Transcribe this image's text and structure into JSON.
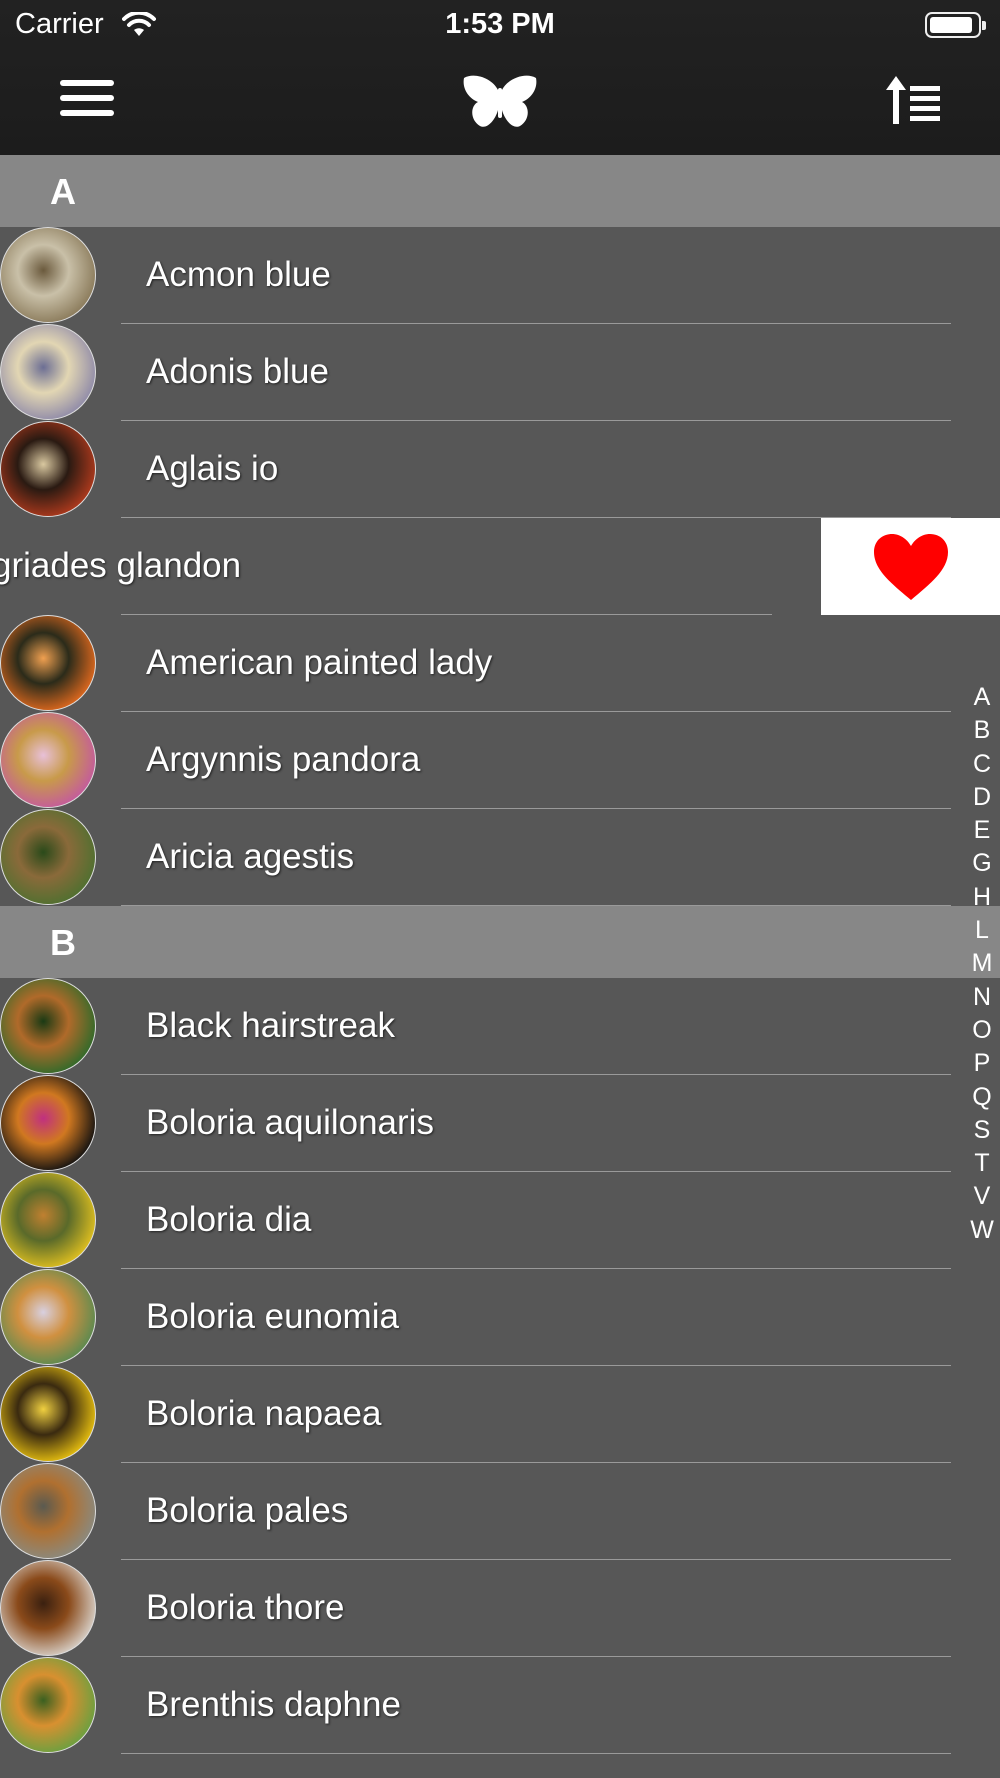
{
  "status_bar": {
    "carrier": "Carrier",
    "time": "1:53 PM"
  },
  "nav": {
    "menu_icon": "hamburger-menu-icon",
    "logo_icon": "butterfly-icon",
    "sort_icon": "sort-ascending-icon"
  },
  "sections": [
    {
      "letter": "A",
      "items": [
        {
          "name": "Acmon blue",
          "colors": [
            "#8a7a5a",
            "#c9c0a8",
            "#6b5a3d"
          ]
        },
        {
          "name": "Adonis blue",
          "colors": [
            "#8f8aa8",
            "#e2d6b3",
            "#6c6e94"
          ]
        },
        {
          "name": "Aglais io",
          "colors": [
            "#b03a1d",
            "#2a1a12",
            "#d9c8a0"
          ]
        },
        {
          "name": "griades glandon",
          "swiped": true,
          "action_icon": "heart-icon",
          "action_color": "#ff0000"
        },
        {
          "name": "American painted lady",
          "colors": [
            "#e0691e",
            "#2b2b1a",
            "#f0a050"
          ]
        },
        {
          "name": "Argynnis pandora",
          "colors": [
            "#c45a9e",
            "#c89a4a",
            "#e8c0d8"
          ]
        },
        {
          "name": "Aricia agestis",
          "colors": [
            "#4f7030",
            "#8a6a3a",
            "#2a4a1a"
          ]
        }
      ]
    },
    {
      "letter": "B",
      "items": [
        {
          "name": "Black hairstreak",
          "colors": [
            "#2f6a2a",
            "#b06a2a",
            "#1a3a14"
          ]
        },
        {
          "name": "Boloria aquilonaris",
          "colors": [
            "#111111",
            "#d07820",
            "#c03080"
          ]
        },
        {
          "name": "Boloria dia",
          "colors": [
            "#e0c020",
            "#5a6a2a",
            "#c08030"
          ]
        },
        {
          "name": "Boloria eunomia",
          "colors": [
            "#5a8a50",
            "#d09040",
            "#d8d0e0"
          ]
        },
        {
          "name": "Boloria napaea",
          "colors": [
            "#e8c010",
            "#3a2a10",
            "#f0d040"
          ]
        },
        {
          "name": "Boloria pales",
          "colors": [
            "#8a8a80",
            "#b07030",
            "#5a5a50"
          ]
        },
        {
          "name": "Boloria thore",
          "colors": [
            "#d8d0c8",
            "#8a4a1a",
            "#3a2010"
          ]
        },
        {
          "name": "Brenthis daphne",
          "colors": [
            "#6aa040",
            "#d89030",
            "#3a6020"
          ]
        }
      ]
    }
  ],
  "index_letters": [
    "A",
    "B",
    "C",
    "D",
    "E",
    "G",
    "H",
    "L",
    "M",
    "N",
    "O",
    "P",
    "Q",
    "S",
    "T",
    "V",
    "W"
  ],
  "colors": {
    "background": "#575757",
    "section_header": "#878787",
    "nav_bar": "#1f1f1f",
    "heart": "#ff0000"
  }
}
